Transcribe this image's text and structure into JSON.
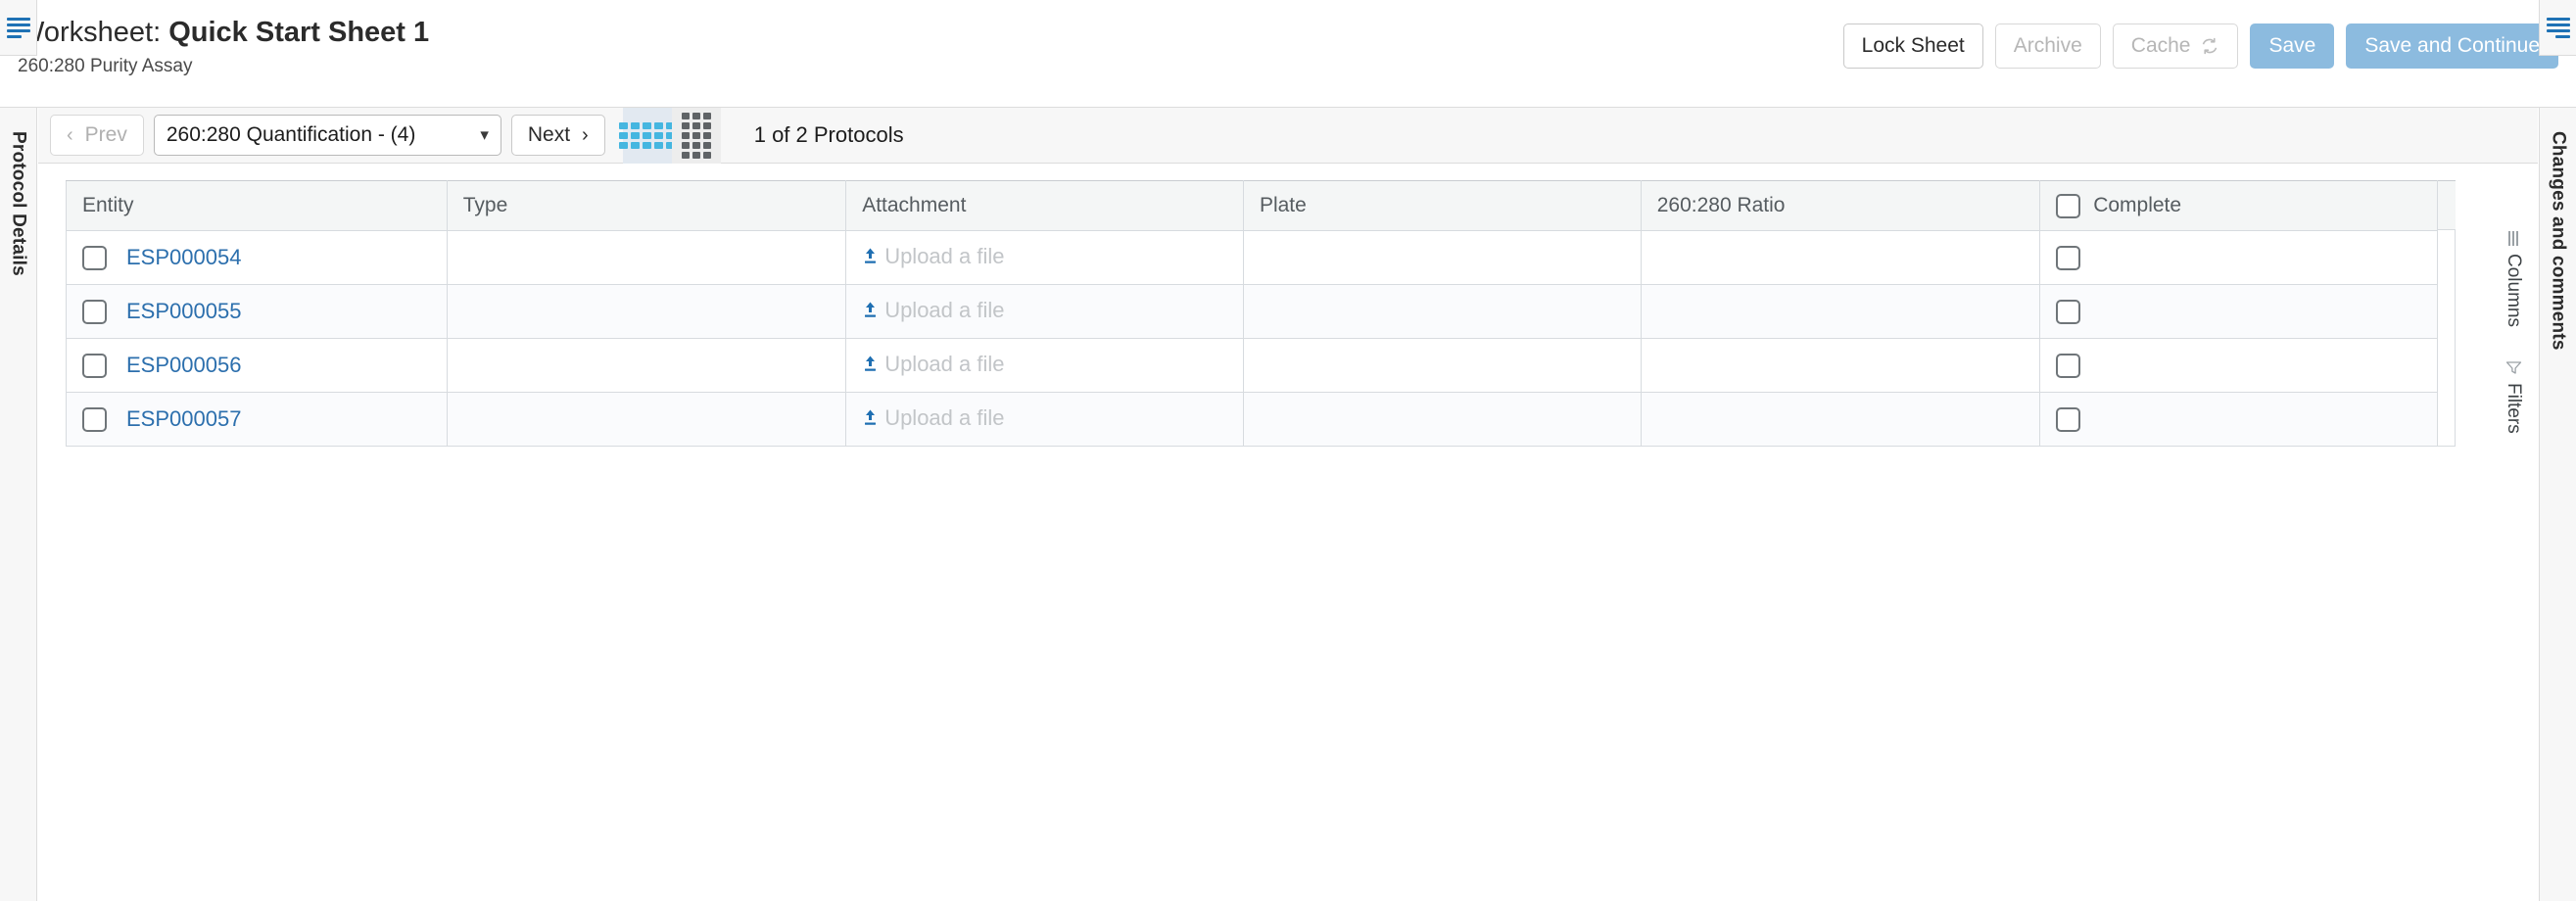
{
  "header": {
    "title_label": "Worksheet:",
    "title_name": "Quick Start Sheet 1",
    "subtitle": "260:280 Purity Assay",
    "actions": [
      {
        "label": "Lock Sheet",
        "state": "enabled",
        "style": "default"
      },
      {
        "label": "Archive",
        "state": "disabled",
        "style": "default"
      },
      {
        "label": "Cache",
        "state": "disabled",
        "style": "default",
        "icon": "refresh-icon"
      },
      {
        "label": "Save",
        "state": "enabled",
        "style": "primary"
      },
      {
        "label": "Save and Continue",
        "state": "enabled",
        "style": "primary"
      }
    ]
  },
  "toolbar": {
    "menu_icon": "hamburger-menu-icon",
    "prev_label": "Prev",
    "prev_state": "disabled",
    "next_label": "Next",
    "next_state": "enabled",
    "protocol_select_value": "260:280 Quantification - (4)",
    "view_toggles": [
      {
        "name": "wide-grid-view",
        "icon": "wide-grid-icon",
        "active": true
      },
      {
        "name": "tall-grid-view",
        "icon": "tall-grid-icon",
        "active": false
      }
    ],
    "protocol_count": "1 of 2 Protocols"
  },
  "left_rail": {
    "label": "Protocol Details",
    "toggle_icon": "hamburger-menu-icon"
  },
  "right_rail": {
    "label": "Changes and comments",
    "toggle_icon": "hamburger-menu-icon"
  },
  "side_strip": {
    "columns_label": "Columns",
    "columns_icon": "columns-icon",
    "filters_label": "Filters",
    "filters_icon": "funnel-icon"
  },
  "table": {
    "columns": [
      {
        "key": "entity",
        "label": "Entity",
        "has_header_checkbox": false
      },
      {
        "key": "type",
        "label": "Type",
        "has_header_checkbox": false
      },
      {
        "key": "attachment",
        "label": "Attachment",
        "has_header_checkbox": false
      },
      {
        "key": "plate",
        "label": "Plate",
        "has_header_checkbox": false
      },
      {
        "key": "ratio",
        "label": "260:280 Ratio",
        "has_header_checkbox": false
      },
      {
        "key": "complete",
        "label": "Complete",
        "has_header_checkbox": true
      }
    ],
    "upload_placeholder": "Upload a file",
    "upload_icon": "upload-icon",
    "rows": [
      {
        "entity": "ESP000054",
        "type": "",
        "attachment": "Upload a file",
        "plate": "",
        "ratio": "",
        "complete": false,
        "checked": false
      },
      {
        "entity": "ESP000055",
        "type": "",
        "attachment": "Upload a file",
        "plate": "",
        "ratio": "",
        "complete": false,
        "checked": false
      },
      {
        "entity": "ESP000056",
        "type": "",
        "attachment": "Upload a file",
        "plate": "",
        "ratio": "",
        "complete": false,
        "checked": false
      },
      {
        "entity": "ESP000057",
        "type": "",
        "attachment": "Upload a file",
        "plate": "",
        "ratio": "",
        "complete": false,
        "checked": false
      }
    ]
  },
  "colors": {
    "link": "#2c6fad",
    "primary_button": "#8cbbdf",
    "accent_blue": "#1f72b5",
    "grid_active_icon": "#45b6e0",
    "header_bg": "#f4f6f6"
  }
}
